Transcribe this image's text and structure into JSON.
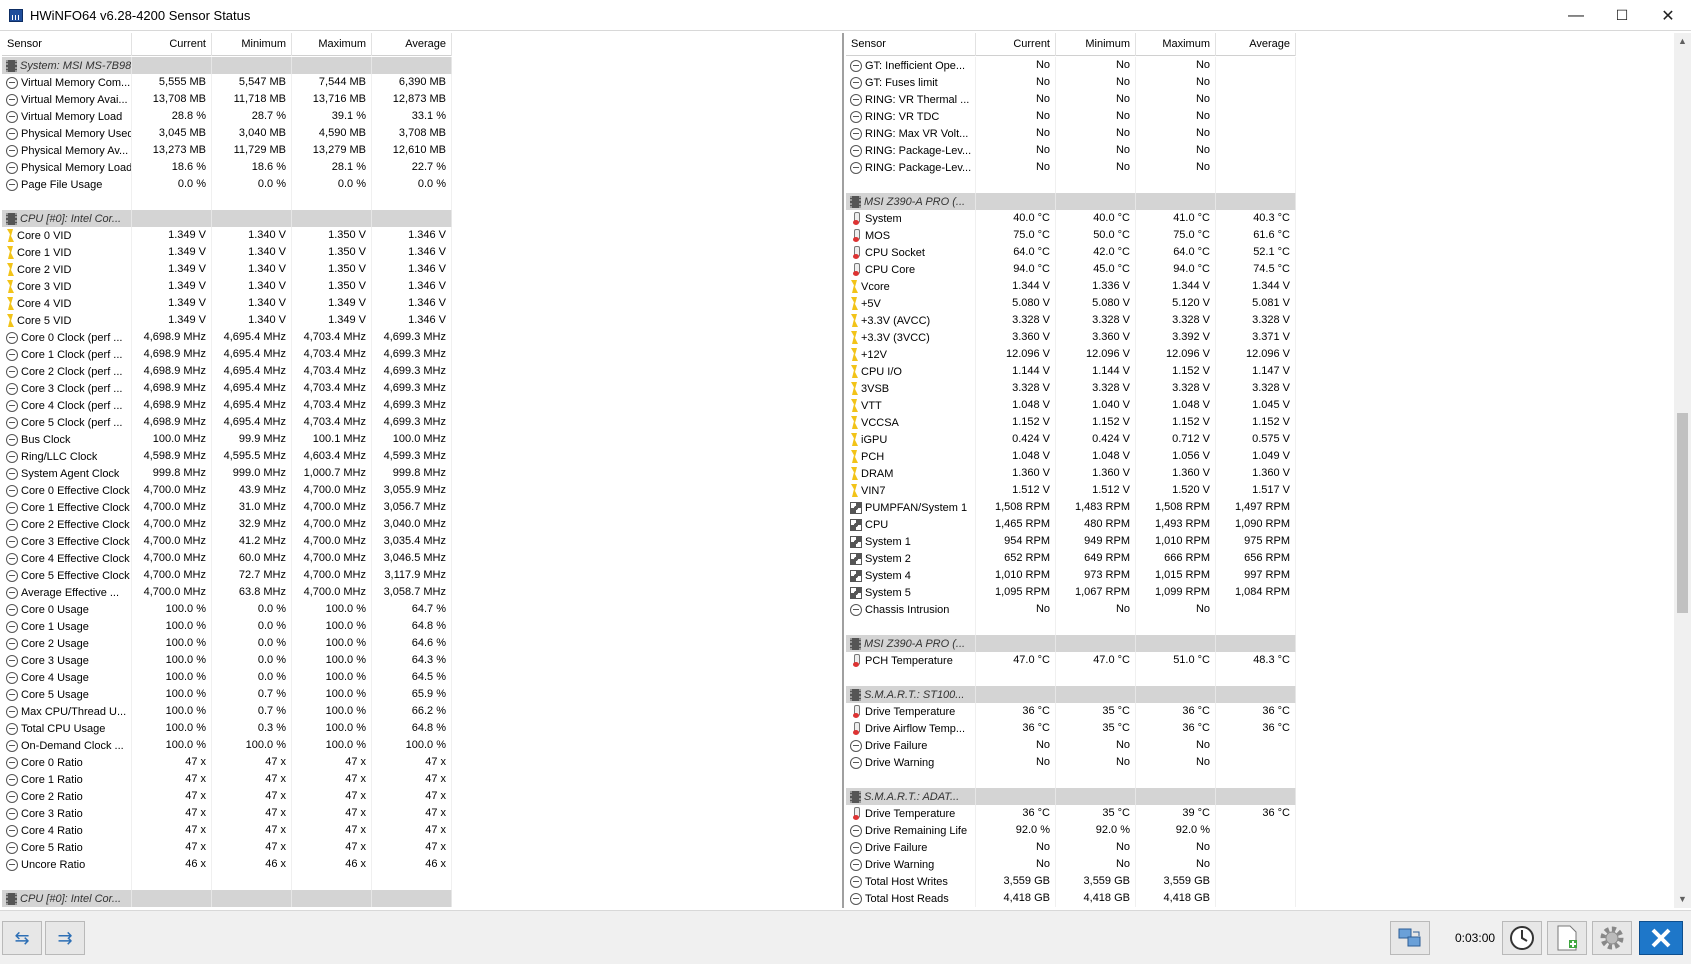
{
  "window": {
    "title": "HWiNFO64 v6.28-4200 Sensor Status",
    "minimize": "—",
    "maximize": "☐",
    "close": "✕"
  },
  "columns": [
    "Sensor",
    "Current",
    "Minimum",
    "Maximum",
    "Average"
  ],
  "left_rows": [
    {
      "t": "g",
      "n": "System: MSI MS-7B98"
    },
    {
      "i": "circle",
      "n": "Virtual Memory Com...",
      "v": [
        "5,555 MB",
        "5,547 MB",
        "7,544 MB",
        "6,390 MB"
      ]
    },
    {
      "i": "circle",
      "n": "Virtual Memory Avai...",
      "v": [
        "13,708 MB",
        "11,718 MB",
        "13,716 MB",
        "12,873 MB"
      ]
    },
    {
      "i": "circle",
      "n": "Virtual Memory Load",
      "v": [
        "28.8 %",
        "28.7 %",
        "39.1 %",
        "33.1 %"
      ]
    },
    {
      "i": "circle",
      "n": "Physical Memory Used",
      "v": [
        "3,045 MB",
        "3,040 MB",
        "4,590 MB",
        "3,708 MB"
      ]
    },
    {
      "i": "circle",
      "n": "Physical Memory Av...",
      "v": [
        "13,273 MB",
        "11,729 MB",
        "13,279 MB",
        "12,610 MB"
      ]
    },
    {
      "i": "circle",
      "n": "Physical Memory Load",
      "v": [
        "18.6 %",
        "18.6 %",
        "28.1 %",
        "22.7 %"
      ]
    },
    {
      "i": "circle",
      "n": "Page File Usage",
      "v": [
        "0.0 %",
        "0.0 %",
        "0.0 %",
        "0.0 %"
      ]
    },
    {
      "t": "b"
    },
    {
      "t": "g",
      "n": "CPU [#0]: Intel Cor..."
    },
    {
      "i": "bolt",
      "n": "Core 0 VID",
      "v": [
        "1.349 V",
        "1.340 V",
        "1.350 V",
        "1.346 V"
      ]
    },
    {
      "i": "bolt",
      "n": "Core 1 VID",
      "v": [
        "1.349 V",
        "1.340 V",
        "1.350 V",
        "1.346 V"
      ]
    },
    {
      "i": "bolt",
      "n": "Core 2 VID",
      "v": [
        "1.349 V",
        "1.340 V",
        "1.350 V",
        "1.346 V"
      ]
    },
    {
      "i": "bolt",
      "n": "Core 3 VID",
      "v": [
        "1.349 V",
        "1.340 V",
        "1.350 V",
        "1.346 V"
      ]
    },
    {
      "i": "bolt",
      "n": "Core 4 VID",
      "v": [
        "1.349 V",
        "1.340 V",
        "1.349 V",
        "1.346 V"
      ]
    },
    {
      "i": "bolt",
      "n": "Core 5 VID",
      "v": [
        "1.349 V",
        "1.340 V",
        "1.349 V",
        "1.346 V"
      ]
    },
    {
      "i": "circle",
      "n": "Core 0 Clock (perf ...",
      "v": [
        "4,698.9 MHz",
        "4,695.4 MHz",
        "4,703.4 MHz",
        "4,699.3 MHz"
      ]
    },
    {
      "i": "circle",
      "n": "Core 1 Clock (perf ...",
      "v": [
        "4,698.9 MHz",
        "4,695.4 MHz",
        "4,703.4 MHz",
        "4,699.3 MHz"
      ]
    },
    {
      "i": "circle",
      "n": "Core 2 Clock (perf ...",
      "v": [
        "4,698.9 MHz",
        "4,695.4 MHz",
        "4,703.4 MHz",
        "4,699.3 MHz"
      ]
    },
    {
      "i": "circle",
      "n": "Core 3 Clock (perf ...",
      "v": [
        "4,698.9 MHz",
        "4,695.4 MHz",
        "4,703.4 MHz",
        "4,699.3 MHz"
      ]
    },
    {
      "i": "circle",
      "n": "Core 4 Clock (perf ...",
      "v": [
        "4,698.9 MHz",
        "4,695.4 MHz",
        "4,703.4 MHz",
        "4,699.3 MHz"
      ]
    },
    {
      "i": "circle",
      "n": "Core 5 Clock (perf ...",
      "v": [
        "4,698.9 MHz",
        "4,695.4 MHz",
        "4,703.4 MHz",
        "4,699.3 MHz"
      ]
    },
    {
      "i": "circle",
      "n": "Bus Clock",
      "v": [
        "100.0 MHz",
        "99.9 MHz",
        "100.1 MHz",
        "100.0 MHz"
      ]
    },
    {
      "i": "circle",
      "n": "Ring/LLC Clock",
      "v": [
        "4,598.9 MHz",
        "4,595.5 MHz",
        "4,603.4 MHz",
        "4,599.3 MHz"
      ]
    },
    {
      "i": "circle",
      "n": "System Agent Clock",
      "v": [
        "999.8 MHz",
        "999.0 MHz",
        "1,000.7 MHz",
        "999.8 MHz"
      ]
    },
    {
      "i": "circle",
      "n": "Core 0 Effective Clock",
      "v": [
        "4,700.0 MHz",
        "43.9 MHz",
        "4,700.0 MHz",
        "3,055.9 MHz"
      ]
    },
    {
      "i": "circle",
      "n": "Core 1 Effective Clock",
      "v": [
        "4,700.0 MHz",
        "31.0 MHz",
        "4,700.0 MHz",
        "3,056.7 MHz"
      ]
    },
    {
      "i": "circle",
      "n": "Core 2 Effective Clock",
      "v": [
        "4,700.0 MHz",
        "32.9 MHz",
        "4,700.0 MHz",
        "3,040.0 MHz"
      ]
    },
    {
      "i": "circle",
      "n": "Core 3 Effective Clock",
      "v": [
        "4,700.0 MHz",
        "41.2 MHz",
        "4,700.0 MHz",
        "3,035.4 MHz"
      ]
    },
    {
      "i": "circle",
      "n": "Core 4 Effective Clock",
      "v": [
        "4,700.0 MHz",
        "60.0 MHz",
        "4,700.0 MHz",
        "3,046.5 MHz"
      ]
    },
    {
      "i": "circle",
      "n": "Core 5 Effective Clock",
      "v": [
        "4,700.0 MHz",
        "72.7 MHz",
        "4,700.0 MHz",
        "3,117.9 MHz"
      ]
    },
    {
      "i": "circle",
      "n": "Average Effective ...",
      "v": [
        "4,700.0 MHz",
        "63.8 MHz",
        "4,700.0 MHz",
        "3,058.7 MHz"
      ]
    },
    {
      "i": "circle",
      "n": "Core 0 Usage",
      "v": [
        "100.0 %",
        "0.0 %",
        "100.0 %",
        "64.7 %"
      ]
    },
    {
      "i": "circle",
      "n": "Core 1 Usage",
      "v": [
        "100.0 %",
        "0.0 %",
        "100.0 %",
        "64.8 %"
      ]
    },
    {
      "i": "circle",
      "n": "Core 2 Usage",
      "v": [
        "100.0 %",
        "0.0 %",
        "100.0 %",
        "64.6 %"
      ]
    },
    {
      "i": "circle",
      "n": "Core 3 Usage",
      "v": [
        "100.0 %",
        "0.0 %",
        "100.0 %",
        "64.3 %"
      ]
    },
    {
      "i": "circle",
      "n": "Core 4 Usage",
      "v": [
        "100.0 %",
        "0.0 %",
        "100.0 %",
        "64.5 %"
      ]
    },
    {
      "i": "circle",
      "n": "Core 5 Usage",
      "v": [
        "100.0 %",
        "0.7 %",
        "100.0 %",
        "65.9 %"
      ]
    },
    {
      "i": "circle",
      "n": "Max CPU/Thread U...",
      "v": [
        "100.0 %",
        "0.7 %",
        "100.0 %",
        "66.2 %"
      ]
    },
    {
      "i": "circle",
      "n": "Total CPU Usage",
      "v": [
        "100.0 %",
        "0.3 %",
        "100.0 %",
        "64.8 %"
      ]
    },
    {
      "i": "circle",
      "n": "On-Demand Clock ...",
      "v": [
        "100.0 %",
        "100.0 %",
        "100.0 %",
        "100.0 %"
      ]
    },
    {
      "i": "circle",
      "n": "Core 0 Ratio",
      "v": [
        "47 x",
        "47 x",
        "47 x",
        "47 x"
      ]
    },
    {
      "i": "circle",
      "n": "Core 1 Ratio",
      "v": [
        "47 x",
        "47 x",
        "47 x",
        "47 x"
      ]
    },
    {
      "i": "circle",
      "n": "Core 2 Ratio",
      "v": [
        "47 x",
        "47 x",
        "47 x",
        "47 x"
      ]
    },
    {
      "i": "circle",
      "n": "Core 3 Ratio",
      "v": [
        "47 x",
        "47 x",
        "47 x",
        "47 x"
      ]
    },
    {
      "i": "circle",
      "n": "Core 4 Ratio",
      "v": [
        "47 x",
        "47 x",
        "47 x",
        "47 x"
      ]
    },
    {
      "i": "circle",
      "n": "Core 5 Ratio",
      "v": [
        "47 x",
        "47 x",
        "47 x",
        "47 x"
      ]
    },
    {
      "i": "circle",
      "n": "Uncore Ratio",
      "v": [
        "46 x",
        "46 x",
        "46 x",
        "46 x"
      ]
    },
    {
      "t": "b"
    },
    {
      "t": "g",
      "n": "CPU [#0]: Intel Cor..."
    }
  ],
  "right_rows": [
    {
      "i": "circle",
      "n": "GT: Inefficient Ope...",
      "v": [
        "No",
        "No",
        "No",
        ""
      ]
    },
    {
      "i": "circle",
      "n": "GT: Fuses limit",
      "v": [
        "No",
        "No",
        "No",
        ""
      ]
    },
    {
      "i": "circle",
      "n": "RING: VR Thermal ...",
      "v": [
        "No",
        "No",
        "No",
        ""
      ]
    },
    {
      "i": "circle",
      "n": "RING: VR TDC",
      "v": [
        "No",
        "No",
        "No",
        ""
      ]
    },
    {
      "i": "circle",
      "n": "RING: Max VR Volt...",
      "v": [
        "No",
        "No",
        "No",
        ""
      ]
    },
    {
      "i": "circle",
      "n": "RING: Package-Lev...",
      "v": [
        "No",
        "No",
        "No",
        ""
      ]
    },
    {
      "i": "circle",
      "n": "RING: Package-Lev...",
      "v": [
        "No",
        "No",
        "No",
        ""
      ]
    },
    {
      "t": "b"
    },
    {
      "t": "g",
      "n": "MSI Z390-A PRO (..."
    },
    {
      "i": "therm",
      "n": "System",
      "v": [
        "40.0 °C",
        "40.0 °C",
        "41.0 °C",
        "40.3 °C"
      ]
    },
    {
      "i": "therm",
      "n": "MOS",
      "v": [
        "75.0 °C",
        "50.0 °C",
        "75.0 °C",
        "61.6 °C"
      ]
    },
    {
      "i": "therm",
      "n": "CPU Socket",
      "v": [
        "64.0 °C",
        "42.0 °C",
        "64.0 °C",
        "52.1 °C"
      ]
    },
    {
      "i": "therm",
      "n": "CPU Core",
      "v": [
        "94.0 °C",
        "45.0 °C",
        "94.0 °C",
        "74.5 °C"
      ]
    },
    {
      "i": "bolt",
      "n": "Vcore",
      "v": [
        "1.344 V",
        "1.336 V",
        "1.344 V",
        "1.344 V"
      ]
    },
    {
      "i": "bolt",
      "n": "+5V",
      "v": [
        "5.080 V",
        "5.080 V",
        "5.120 V",
        "5.081 V"
      ]
    },
    {
      "i": "bolt",
      "n": "+3.3V (AVCC)",
      "v": [
        "3.328 V",
        "3.328 V",
        "3.328 V",
        "3.328 V"
      ]
    },
    {
      "i": "bolt",
      "n": "+3.3V (3VCC)",
      "v": [
        "3.360 V",
        "3.360 V",
        "3.392 V",
        "3.371 V"
      ]
    },
    {
      "i": "bolt",
      "n": "+12V",
      "v": [
        "12.096 V",
        "12.096 V",
        "12.096 V",
        "12.096 V"
      ]
    },
    {
      "i": "bolt",
      "n": "CPU I/O",
      "v": [
        "1.144 V",
        "1.144 V",
        "1.152 V",
        "1.147 V"
      ]
    },
    {
      "i": "bolt",
      "n": "3VSB",
      "v": [
        "3.328 V",
        "3.328 V",
        "3.328 V",
        "3.328 V"
      ]
    },
    {
      "i": "bolt",
      "n": "VTT",
      "v": [
        "1.048 V",
        "1.040 V",
        "1.048 V",
        "1.045 V"
      ]
    },
    {
      "i": "bolt",
      "n": "VCCSA",
      "v": [
        "1.152 V",
        "1.152 V",
        "1.152 V",
        "1.152 V"
      ]
    },
    {
      "i": "bolt",
      "n": "iGPU",
      "v": [
        "0.424 V",
        "0.424 V",
        "0.712 V",
        "0.575 V"
      ]
    },
    {
      "i": "bolt",
      "n": "PCH",
      "v": [
        "1.048 V",
        "1.048 V",
        "1.056 V",
        "1.049 V"
      ]
    },
    {
      "i": "bolt",
      "n": "DRAM",
      "v": [
        "1.360 V",
        "1.360 V",
        "1.360 V",
        "1.360 V"
      ]
    },
    {
      "i": "bolt",
      "n": "VIN7",
      "v": [
        "1.512 V",
        "1.512 V",
        "1.520 V",
        "1.517 V"
      ]
    },
    {
      "i": "fan",
      "n": "PUMPFAN/System 1",
      "v": [
        "1,508 RPM",
        "1,483 RPM",
        "1,508 RPM",
        "1,497 RPM"
      ]
    },
    {
      "i": "fan",
      "n": "CPU",
      "v": [
        "1,465 RPM",
        "480 RPM",
        "1,493 RPM",
        "1,090 RPM"
      ]
    },
    {
      "i": "fan",
      "n": "System 1",
      "v": [
        "954 RPM",
        "949 RPM",
        "1,010 RPM",
        "975 RPM"
      ]
    },
    {
      "i": "fan",
      "n": "System 2",
      "v": [
        "652 RPM",
        "649 RPM",
        "666 RPM",
        "656 RPM"
      ]
    },
    {
      "i": "fan",
      "n": "System 4",
      "v": [
        "1,010 RPM",
        "973 RPM",
        "1,015 RPM",
        "997 RPM"
      ]
    },
    {
      "i": "fan",
      "n": "System 5",
      "v": [
        "1,095 RPM",
        "1,067 RPM",
        "1,099 RPM",
        "1,084 RPM"
      ]
    },
    {
      "i": "circle",
      "n": "Chassis Intrusion",
      "v": [
        "No",
        "No",
        "No",
        ""
      ]
    },
    {
      "t": "b"
    },
    {
      "t": "g",
      "n": "MSI Z390-A PRO (..."
    },
    {
      "i": "therm",
      "n": "PCH Temperature",
      "v": [
        "47.0 °C",
        "47.0 °C",
        "51.0 °C",
        "48.3 °C"
      ]
    },
    {
      "t": "b"
    },
    {
      "t": "g",
      "n": "S.M.A.R.T.: ST100..."
    },
    {
      "i": "therm",
      "n": "Drive Temperature",
      "v": [
        "36 °C",
        "35 °C",
        "36 °C",
        "36 °C"
      ]
    },
    {
      "i": "therm",
      "n": "Drive Airflow Temp...",
      "v": [
        "36 °C",
        "35 °C",
        "36 °C",
        "36 °C"
      ]
    },
    {
      "i": "circle",
      "n": "Drive Failure",
      "v": [
        "No",
        "No",
        "No",
        ""
      ]
    },
    {
      "i": "circle",
      "n": "Drive Warning",
      "v": [
        "No",
        "No",
        "No",
        ""
      ]
    },
    {
      "t": "b"
    },
    {
      "t": "g",
      "n": "S.M.A.R.T.: ADAT..."
    },
    {
      "i": "therm",
      "n": "Drive Temperature",
      "v": [
        "36 °C",
        "35 °C",
        "39 °C",
        "36 °C"
      ]
    },
    {
      "i": "circle",
      "n": "Drive Remaining Life",
      "v": [
        "92.0 %",
        "92.0 %",
        "92.0 %",
        ""
      ]
    },
    {
      "i": "circle",
      "n": "Drive Failure",
      "v": [
        "No",
        "No",
        "No",
        ""
      ]
    },
    {
      "i": "circle",
      "n": "Drive Warning",
      "v": [
        "No",
        "No",
        "No",
        ""
      ]
    },
    {
      "i": "circle",
      "n": "Total Host Writes",
      "v": [
        "3,559 GB",
        "3,559 GB",
        "3,559 GB",
        ""
      ]
    },
    {
      "i": "circle",
      "n": "Total Host Reads",
      "v": [
        "4,418 GB",
        "4,418 GB",
        "4,418 GB",
        ""
      ]
    }
  ],
  "statusbar": {
    "elapsed": "0:03:00",
    "nav_left_icon": "⇆",
    "nav_right_icon": "⇉"
  }
}
